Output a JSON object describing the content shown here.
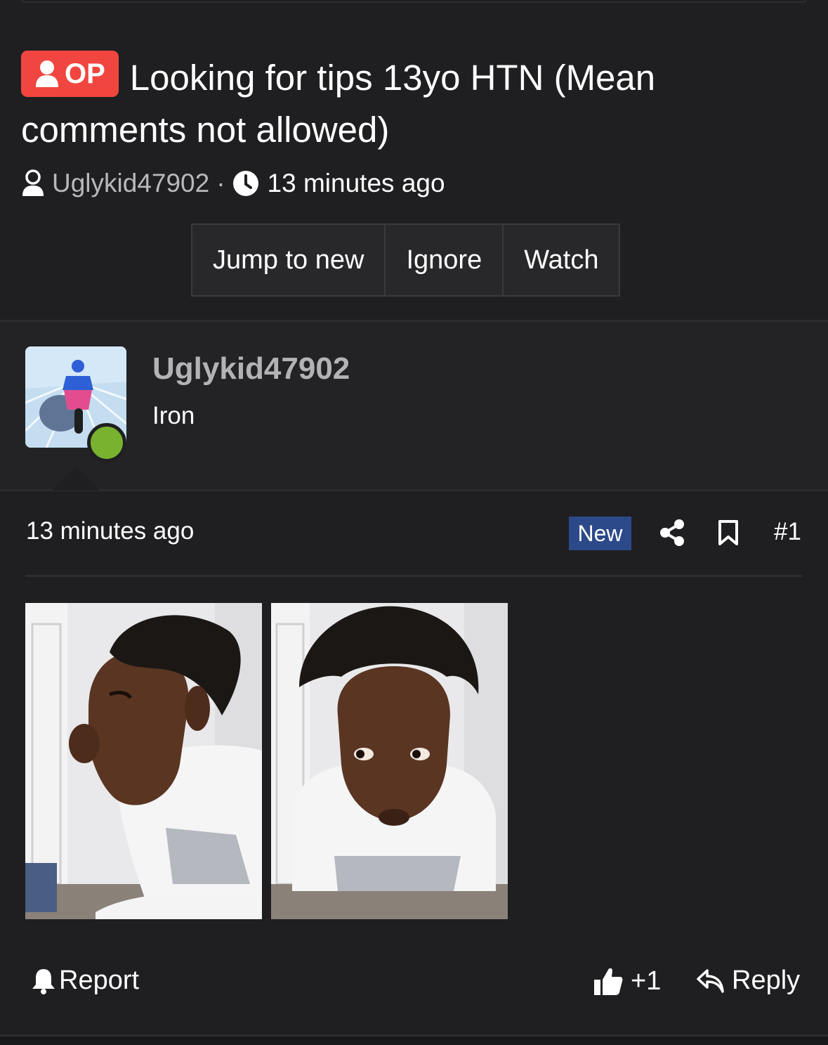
{
  "thread": {
    "op_badge": "OP",
    "title": "Looking for tips 13yo HTN (Mean comments not allowed)",
    "author": "Uglykid47902",
    "separator": "·",
    "time": "13 minutes ago"
  },
  "actions": {
    "jump_to_new": "Jump to new",
    "ignore": "Ignore",
    "watch": "Watch"
  },
  "post": {
    "username": "Uglykid47902",
    "user_title": "Iron",
    "online": true,
    "time": "13 minutes ago",
    "new_badge": "New",
    "number": "#1",
    "attachments": [
      "profile-photo",
      "front-photo"
    ]
  },
  "footer": {
    "report": "Report",
    "like_count": "+1",
    "reply": "Reply"
  },
  "colors": {
    "background": "#1f1f21",
    "op_badge": "#f0463f",
    "new_badge": "#2c4a8a",
    "online": "#79b22f"
  },
  "icons": [
    "user-icon",
    "clock-icon",
    "share-icon",
    "bookmark-icon",
    "bell-icon",
    "thumbs-up-icon",
    "reply-arrow-icon"
  ]
}
